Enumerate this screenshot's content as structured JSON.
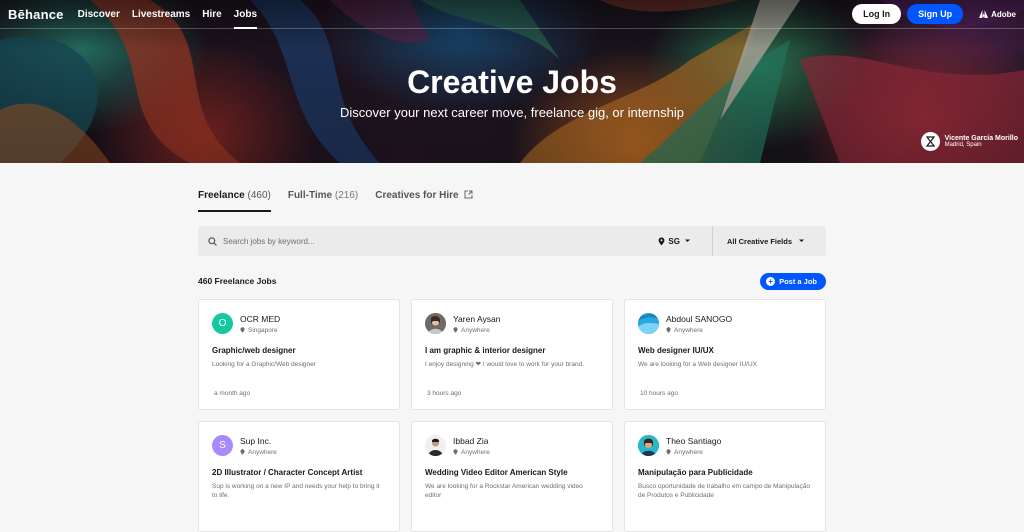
{
  "nav": {
    "logo": "Bēhance",
    "links": [
      "Discover",
      "Livestreams",
      "Hire",
      "Jobs"
    ],
    "login": "Log In",
    "signup": "Sign Up",
    "adobe": "Adobe"
  },
  "hero": {
    "title": "Creative Jobs",
    "subtitle": "Discover your next career move, freelance gig, or internship",
    "credit_name": "Vicente García Morillo",
    "credit_location": "Madrid, Spain"
  },
  "tabs": [
    {
      "label": "Freelance",
      "count": "(460)"
    },
    {
      "label": "Full-Time",
      "count": "(216)"
    },
    {
      "label": "Creatives for Hire",
      "count": ""
    }
  ],
  "search": {
    "placeholder": "Search jobs by keyword...",
    "location": "SG",
    "fields": "All Creative Fields"
  },
  "list": {
    "count_label": "460 Freelance Jobs",
    "post_button": "Post a Job"
  },
  "jobs": [
    {
      "name": "OCR MED",
      "location": "Singapore",
      "title": "Graphic/web designer",
      "desc": "Looking for a Graphic/Web designer",
      "time": "a month ago",
      "avatar_letter": "O",
      "avatar_color": "#14c8a0"
    },
    {
      "name": "Yaren Aysan",
      "location": "Anywhere",
      "title": "I am graphic & interior designer",
      "desc": "I enjoy designing ❤ I would love to work for your brand.",
      "time": "3 hours ago",
      "avatar_letter": "",
      "avatar_color": "#8a8a8a"
    },
    {
      "name": "Abdoul SANOGO",
      "location": "Anywhere",
      "title": "Web designer IU/UX",
      "desc": "We are looking for a Web designer IU/UX",
      "time": "10 hours ago",
      "avatar_letter": "",
      "avatar_color": "#29a8e0"
    },
    {
      "name": "Sup Inc.",
      "location": "Anywhere",
      "title": "2D Illustrator / Character Concept Artist",
      "desc": "Sup is working on a new IP and needs your help to bring it to life.",
      "time": "",
      "avatar_letter": "S",
      "avatar_color": "#a78bfa"
    },
    {
      "name": "Ibbad Zia",
      "location": "Anywhere",
      "title": "Wedding Video Editor American Style",
      "desc": "We are looking for a Rockstar American wedding video editor",
      "time": "",
      "avatar_letter": "",
      "avatar_color": "#3a3a3a"
    },
    {
      "name": "Theo Santiago",
      "location": "Anywhere",
      "title": "Manipulação para Publicidade",
      "desc": "Busco oportunidade de trabalho em campo de Manipulação de Produtos e Publicidade",
      "time": "",
      "avatar_letter": "",
      "avatar_color": "#2bb5c9"
    }
  ]
}
